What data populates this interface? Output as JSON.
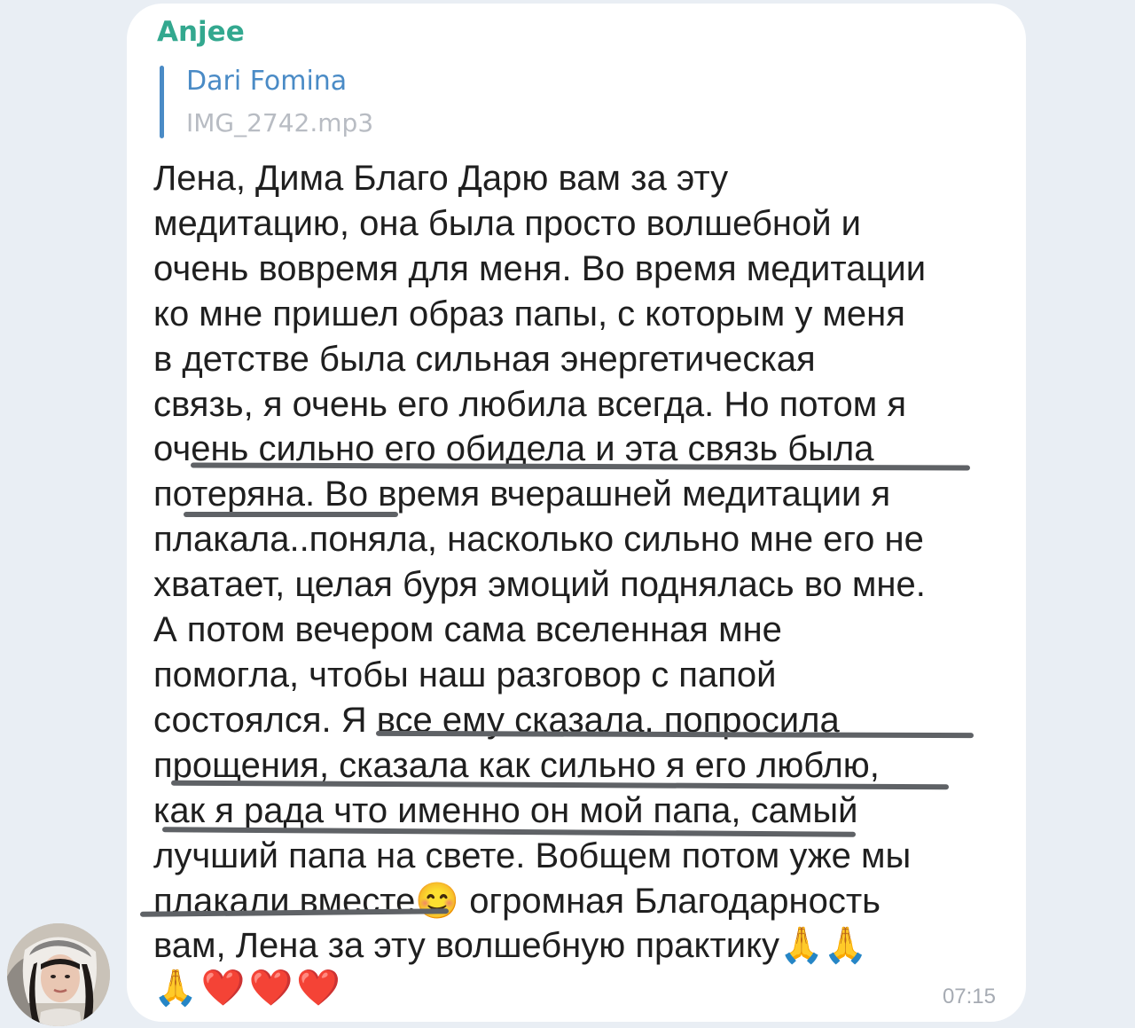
{
  "message": {
    "sender_name": "Anjee",
    "reply": {
      "author": "Dari Fomina",
      "file_name": "IMG_2742.mp3"
    },
    "text": "Лена, Дима Благо Дарю вам за эту\nмедитацию, она была просто волшебной и\nочень вовремя для меня. Во время медитации\nко мне пришел образ папы, с которым у меня\nв детстве была  сильная энергетическая\nсвязь, я очень его любила всегда. Но потом я\nочень сильно его обидела и эта связь была\nпотеряна. Во время вчерашней медитации я\nплакала..поняла, насколько сильно мне его не\nхватает, целая буря эмоций поднялась во мне.\nА потом вечером сама вселенная мне\nпомогла, чтобы наш разговор с папой\nсостоялся. Я все ему сказала, попросила\nпрощения, сказала как сильно я его люблю,\nкак я рада что именно он мой папа, самый\nлучший папа на свете. Вобщем потом уже мы\nплакали вместе😊 огромная Благодарность\nвам, Лена за эту волшебную практику🙏🙏",
    "trailing_emojis": "🙏❤️❤️❤️",
    "time": "07:15"
  },
  "colors": {
    "background": "#e9eef4",
    "bubble": "#ffffff",
    "sender_name": "#33a88f",
    "reply_accent": "#4a8bc6",
    "reply_file": "#b8bcc3",
    "text": "#1f1f1f",
    "underline_marks": "#5f6266",
    "time": "#a6abb3"
  },
  "icons": {
    "avatar": "user-avatar-photo"
  }
}
